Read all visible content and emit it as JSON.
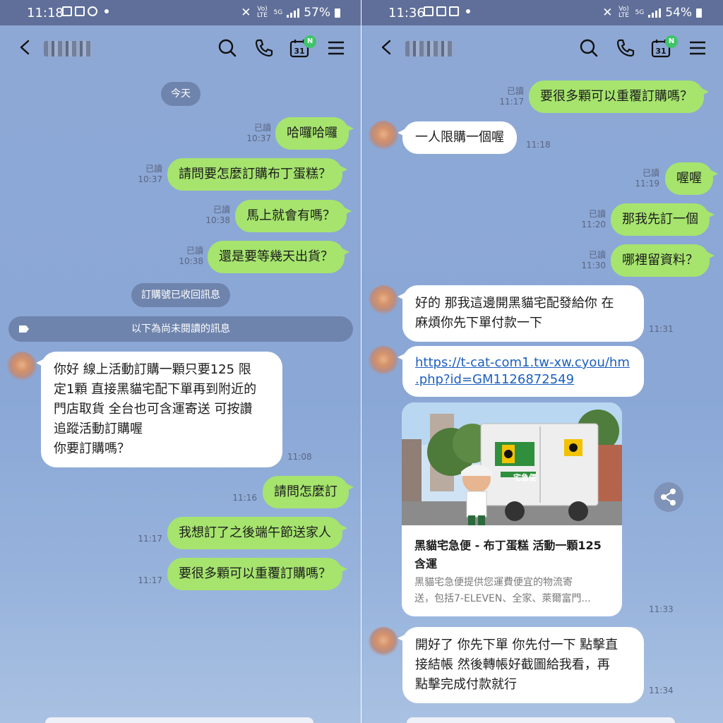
{
  "left": {
    "status": {
      "time": "11:18",
      "battery": "57%",
      "net_top": "Vo) LTE",
      "net_5g": "5G"
    },
    "header": {
      "calendar_day": "31",
      "calendar_badge": "N"
    },
    "date_pill": "今天",
    "recalled_notice": "訂購號已收回訊息",
    "unread_notice": "以下為尚未閱讀的訊息",
    "messages": [
      {
        "dir": "out",
        "read": "已讀",
        "time": "10:37",
        "text": "哈囉哈囉"
      },
      {
        "dir": "out",
        "read": "已讀",
        "time": "10:37",
        "text": "請問要怎麼訂購布丁蛋糕？"
      },
      {
        "dir": "out",
        "read": "已讀",
        "time": "10:38",
        "text": "馬上就會有嗎？"
      },
      {
        "dir": "out",
        "read": "已讀",
        "time": "10:38",
        "text": "還是要等幾天出貨？"
      },
      {
        "dir": "in",
        "time": "11:08",
        "lines": [
          "你好 線上活動訂購一顆只要125 限",
          "定1顆 直接黑貓宅配下單再到附近的",
          "門店取貨 全台也可含運寄送 可按讚",
          "追蹤活動訂購喔",
          "你要訂購嗎？"
        ]
      },
      {
        "dir": "out",
        "read": "",
        "time": "11:16",
        "text": "請問怎麼訂"
      },
      {
        "dir": "out",
        "read": "",
        "time": "11:17",
        "text": "我想訂了之後端午節送家人"
      },
      {
        "dir": "out",
        "read": "",
        "time": "11:17",
        "text": "要很多顆可以重覆訂購嗎？"
      }
    ]
  },
  "right": {
    "status": {
      "time": "11:36",
      "battery": "54%",
      "net_top": "Vo) LTE",
      "net_5g": "5G"
    },
    "header": {
      "calendar_day": "31",
      "calendar_badge": "N"
    },
    "messages": [
      {
        "dir": "out",
        "read": "已讀",
        "time": "11:17",
        "text": "要很多顆可以重覆訂購嗎？"
      },
      {
        "dir": "in",
        "time": "11:18",
        "lines": [
          "一人限購一個喔"
        ]
      },
      {
        "dir": "out",
        "read": "已讀",
        "time": "11:19",
        "text": "喔喔"
      },
      {
        "dir": "out",
        "read": "已讀",
        "time": "11:20",
        "text": "那我先訂一個"
      },
      {
        "dir": "out",
        "read": "已讀",
        "time": "11:30",
        "text": "哪裡留資料？"
      },
      {
        "dir": "in",
        "time": "11:31",
        "lines": [
          "好的 那我這邊開黑貓宅配發給你 在",
          "麻煩你先下單付款一下"
        ]
      },
      {
        "dir": "in",
        "time": "",
        "link": true,
        "lines": [
          "https://t-cat-com1.tw-xw.cyou/hm",
          ".php?id=GM1126872549"
        ]
      },
      {
        "dir": "in",
        "time": "11:34",
        "lines": [
          "開好了 你先下單 你先付一下 點擊直",
          "接結帳 然後轉帳好截圖給我看，再",
          "點擊完成付款就行"
        ]
      }
    ],
    "card": {
      "title_lines": [
        "黑貓宅急便 - 布丁蛋糕 活動一顆125",
        "含運"
      ],
      "desc_lines": [
        "黑貓宅急便提供您運費便宜的物流寄",
        "送，包括7-ELEVEN、全家、萊爾富門..."
      ],
      "time": "11:33",
      "truck_sign": "宅急便"
    }
  },
  "colors": {
    "out_bubble": "#a6e46e",
    "in_bubble": "#ffffff",
    "chat_bg": "#8ea8d5",
    "pill": "#6f84ad",
    "link": "#1d5fbf"
  }
}
